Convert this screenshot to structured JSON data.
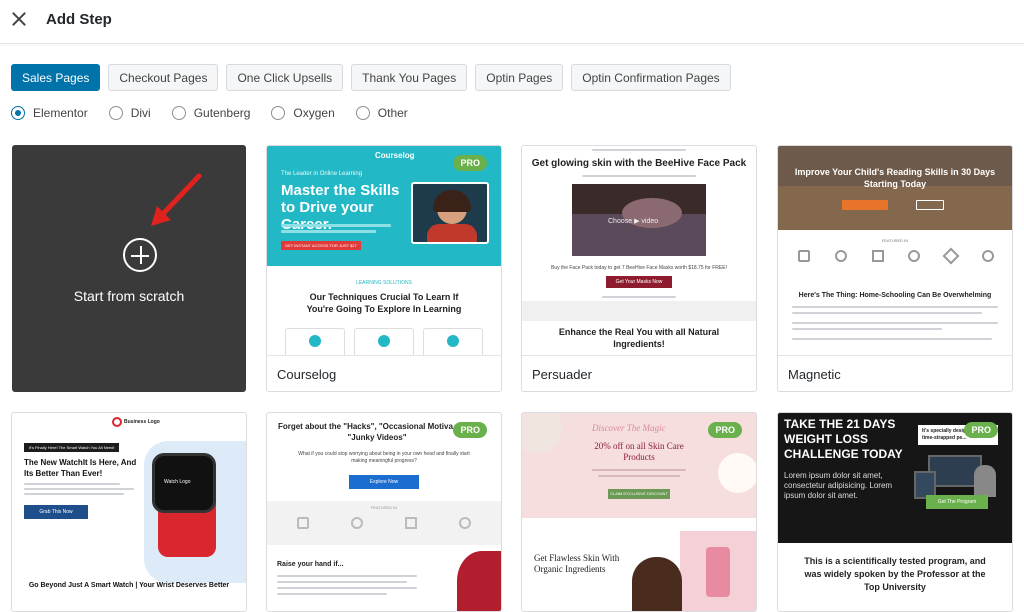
{
  "header": {
    "title": "Add Step"
  },
  "tabs": [
    {
      "label": "Sales Pages",
      "active": true
    },
    {
      "label": "Checkout Pages"
    },
    {
      "label": "One Click Upsells"
    },
    {
      "label": "Thank You Pages"
    },
    {
      "label": "Optin Pages"
    },
    {
      "label": "Optin Confirmation Pages"
    }
  ],
  "builders": [
    {
      "label": "Elementor",
      "checked": true
    },
    {
      "label": "Divi"
    },
    {
      "label": "Gutenberg"
    },
    {
      "label": "Oxygen"
    },
    {
      "label": "Other"
    }
  ],
  "scratch": {
    "label": "Start from scratch"
  },
  "badge": "PRO",
  "templates": {
    "courselog": {
      "name": "Courselog",
      "brand": "Courselog",
      "tagline": "The Leader in Online Learning",
      "headline": "Master the Skills to Drive your Career.",
      "section": "LEARNING SOLUTIONS",
      "subhead": "Our Techniques Crucial To Learn If You're Going To Explore In Learning",
      "cta": "GET INSTANT ACCESS FOR JUST $27"
    },
    "persuader": {
      "name": "Persuader",
      "headline": "Get glowing skin with the BeeHive Face Pack",
      "video": "Choose ▶ video",
      "offer": "Buy the Face Pack today to get 7 BeeHive Face Masks worth $18.75 for FREE!",
      "cta": "Get Your Masks Now",
      "subhead": "Enhance the Real You with all Natural Ingredients!"
    },
    "magnetic": {
      "name": "Magnetic",
      "headline": "Improve Your Child's Reading Skills in 30 Days Starting Today",
      "featured": "FEATURED IN",
      "subhead": "Here's The Thing: Home-Schooling Can Be Overwhelming"
    },
    "watch": {
      "logo": "Business Logo",
      "ribbon": "It's Finally Here! The Smart Watch You All Need!",
      "headline": "The New WatchIt Is Here, And Its Better Than Ever!",
      "cta": "Grab This Now",
      "watch_logo": "Watch Logo",
      "footer": "Go Beyond Just A Smart Watch | Your Wrist Deserves Better"
    },
    "hacks": {
      "headline": "Forget about the \"Hacks\", \"Occasional Motiva... and \"Junky Videos\"",
      "sub": "What if you could stop worrying about being in your own head and finally start making meaningful progress?",
      "cta": "Explore Now",
      "featured": "FEATURED IN",
      "raise": "Raise your hand if..."
    },
    "skin": {
      "script": "Discover The Magic",
      "offer": "20% off on all Skin Care Products",
      "cta": "CLAIM EXCLUSIVE DISCOUNT",
      "subhead": "Get Flawless Skin With Organic Ingredients"
    },
    "challenge": {
      "headline": "TAKE THE 21 DAYS WEIGHT LOSS CHALLENGE TODAY",
      "lorem": "Lorem ipsum dolor sit amet, consectetur adipisicing. Lorem ipsum dolor sit amet.",
      "side": "It's specially designed for time-strapped pe...",
      "cta": "Get The Program",
      "footer": "This is a scientifically tested program, and was widely spoken by the Professor at the Top University"
    }
  }
}
